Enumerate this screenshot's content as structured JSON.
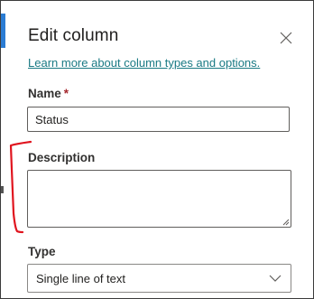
{
  "panel": {
    "title": "Edit column",
    "learn_more_link": "Learn more about column types and options."
  },
  "fields": {
    "name": {
      "label": "Name",
      "required_marker": "*",
      "value": "Status"
    },
    "description": {
      "label": "Description",
      "value": ""
    },
    "type": {
      "label": "Type",
      "selected": "Single line of text"
    }
  },
  "icons": {
    "close": "close-icon",
    "chevron": "chevron-down-icon"
  },
  "colors": {
    "accent": "#2b7cd3",
    "link": "#1a7a84",
    "required": "#a4262c",
    "annotation": "#e0141e"
  }
}
